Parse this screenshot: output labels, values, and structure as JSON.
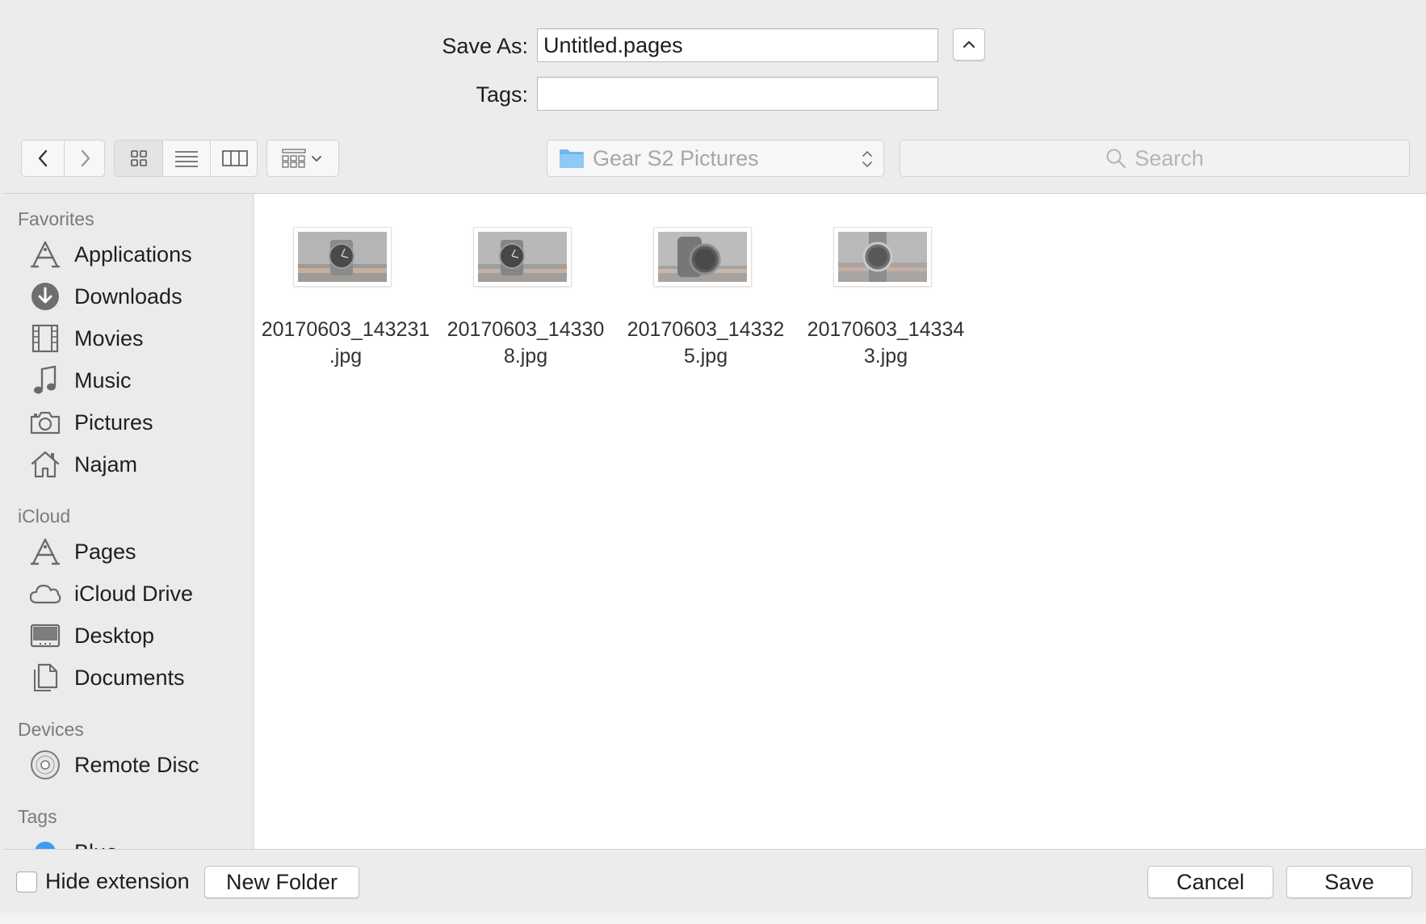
{
  "save_as": {
    "label": "Save As:",
    "value": "Untitled.pages"
  },
  "tags_field": {
    "label": "Tags:",
    "value": ""
  },
  "toolbar": {
    "location": "Gear S2 Pictures",
    "search_placeholder": "Search"
  },
  "sidebar": {
    "favorites_header": "Favorites",
    "favorites": [
      {
        "label": "Applications",
        "icon": "applications-icon"
      },
      {
        "label": "Downloads",
        "icon": "downloads-icon"
      },
      {
        "label": "Movies",
        "icon": "movies-icon"
      },
      {
        "label": "Music",
        "icon": "music-icon"
      },
      {
        "label": "Pictures",
        "icon": "camera-icon"
      },
      {
        "label": "Najam",
        "icon": "home-icon"
      }
    ],
    "icloud_header": "iCloud",
    "icloud": [
      {
        "label": "Pages",
        "icon": "pages-app-icon"
      },
      {
        "label": "iCloud Drive",
        "icon": "cloud-icon"
      },
      {
        "label": "Desktop",
        "icon": "desktop-icon"
      },
      {
        "label": "Documents",
        "icon": "documents-icon"
      }
    ],
    "devices_header": "Devices",
    "devices": [
      {
        "label": "Remote Disc",
        "icon": "disc-icon"
      }
    ],
    "tags_header": "Tags",
    "tags": [
      {
        "label": "Blue",
        "color": "#3d9cf0"
      }
    ]
  },
  "files": [
    {
      "line1": "20170603_143231",
      "line2": ".jpg"
    },
    {
      "line1": "20170603_14330",
      "line2": "8.jpg"
    },
    {
      "line1": "20170603_14332",
      "line2": "5.jpg"
    },
    {
      "line1": "20170603_14334",
      "line2": "3.jpg"
    }
  ],
  "footer": {
    "hide_extension": "Hide extension",
    "hide_extension_checked": false,
    "new_folder": "New Folder",
    "cancel": "Cancel",
    "save": "Save"
  }
}
